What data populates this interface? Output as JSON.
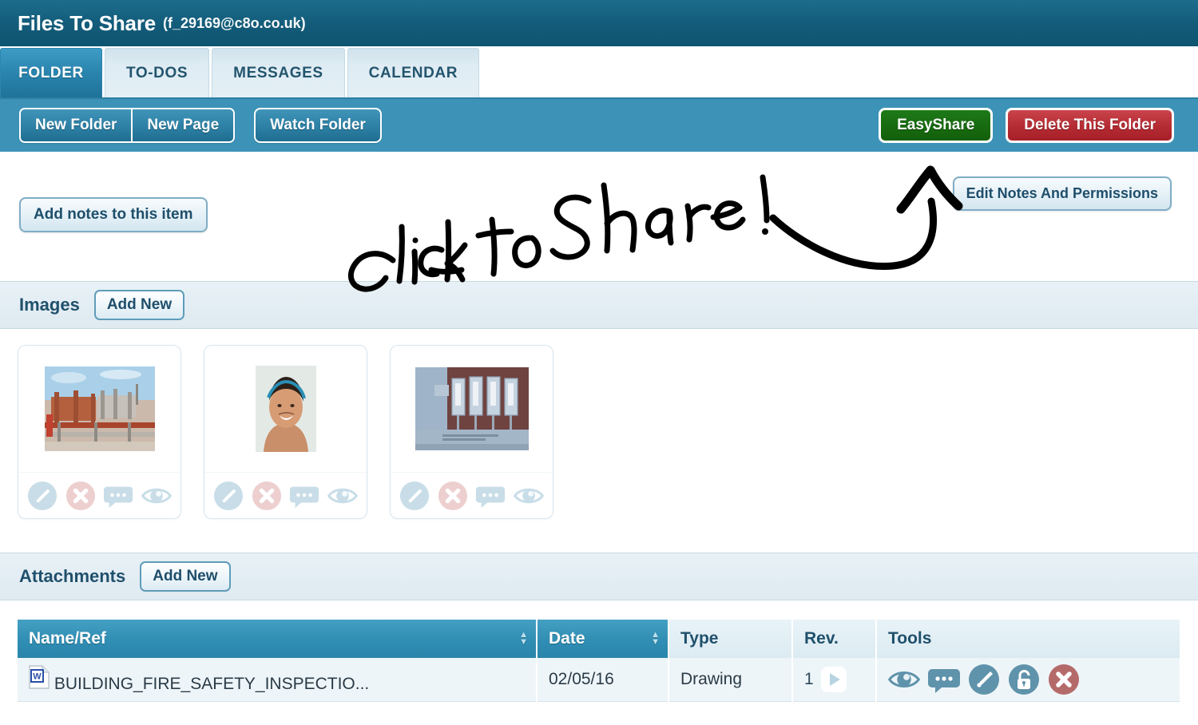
{
  "titlebar": {
    "title": "Files To Share",
    "account": "(f_29169@c8o.co.uk)"
  },
  "tabs": [
    {
      "label": "FOLDER",
      "active": true
    },
    {
      "label": "TO-DOS",
      "active": false
    },
    {
      "label": "MESSAGES",
      "active": false
    },
    {
      "label": "CALENDAR",
      "active": false
    }
  ],
  "actionbar": {
    "new_folder": "New Folder",
    "new_page": "New Page",
    "watch_folder": "Watch Folder",
    "easyshare": "EasyShare",
    "delete_folder": "Delete This Folder"
  },
  "notes": {
    "add_notes": "Add notes to this item",
    "edit_permissions": "Edit Notes And Permissions",
    "annotation_text": "Click to Share!"
  },
  "images_section": {
    "title": "Images",
    "add_new": "Add New",
    "cards": [
      {
        "alt": "construction-site-thumbnail",
        "tools": [
          "marker-icon",
          "delete-icon",
          "comment-icon",
          "view-icon"
        ]
      },
      {
        "alt": "portrait-woman-thumbnail",
        "tools": [
          "marker-icon",
          "delete-icon",
          "comment-icon",
          "view-icon"
        ]
      },
      {
        "alt": "machinery-row-thumbnail",
        "tools": [
          "marker-icon",
          "delete-icon",
          "comment-icon",
          "view-icon"
        ]
      }
    ]
  },
  "attachments_section": {
    "title": "Attachments",
    "add_new": "Add New",
    "columns": [
      {
        "label": "Name/Ref",
        "sorted": true,
        "sortable": true
      },
      {
        "label": "Date",
        "sorted": true,
        "sortable": true
      },
      {
        "label": "Type",
        "sorted": false,
        "sortable": false
      },
      {
        "label": "Rev.",
        "sorted": false,
        "sortable": false
      },
      {
        "label": "Tools",
        "sorted": false,
        "sortable": false
      }
    ],
    "rows": [
      {
        "file_icon": "word-document-icon",
        "name": "BUILDING_FIRE_SAFETY_INSPECTIO...",
        "date": "02/05/16",
        "type": "Drawing",
        "rev": "1",
        "tools": [
          "view-icon",
          "comment-icon",
          "marker-icon",
          "unlock-icon",
          "delete-icon"
        ]
      }
    ]
  },
  "colors": {
    "brand_dark": "#0e5570",
    "brand_mid": "#3d93b7",
    "tab_active": "#2b86b0",
    "green": "#17690f",
    "red": "#b52b33",
    "panel_light": "#e7f1f6",
    "row_bg": "#eef5f8"
  }
}
